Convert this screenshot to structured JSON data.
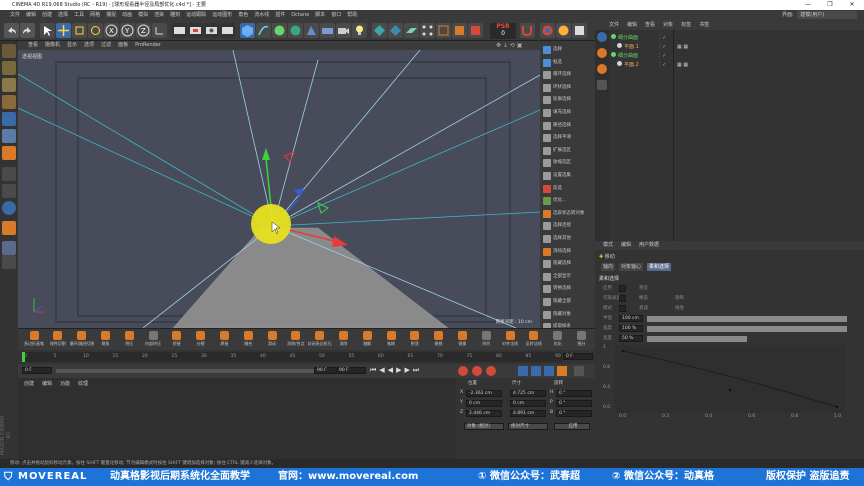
{
  "window": {
    "title": "CINEMA 4D R19.068 Studio (RC - R19) - [球形观看器半径及局部优化.c4d *] - 主要",
    "controls": [
      "—",
      "❐",
      "✕"
    ]
  },
  "menu": [
    "文件",
    "编辑",
    "创建",
    "选择",
    "工具",
    "网格",
    "捕捉",
    "动画",
    "模拟",
    "渲染",
    "雕刻",
    "运动跟踪",
    "运动图形",
    "角色",
    "流水线",
    "插件",
    "Octane",
    "脚本",
    "窗口",
    "帮助"
  ],
  "layout": {
    "label": "界面:",
    "value": "建模(用户)"
  },
  "psr": {
    "label": "PSR",
    "value": "0"
  },
  "viewport": {
    "menu": [
      "查看",
      "摄像机",
      "显示",
      "选项",
      "过滤",
      "面板",
      "ProRender"
    ],
    "name": "透视视图",
    "grid_label": "网格间距 : 10 cm"
  },
  "right_tools": [
    {
      "label": "选择",
      "color": "#4a8fd8"
    },
    {
      "label": "框选",
      "color": "#4a8fd8"
    },
    {
      "label": "循环选择",
      "color": "#9a9a9a"
    },
    {
      "label": "环状选择",
      "color": "#9a9a9a"
    },
    {
      "label": "轮廓选择",
      "color": "#9a9a9a"
    },
    {
      "label": "填充选择",
      "color": "#9a9a9a"
    },
    {
      "label": "路径选择",
      "color": "#9a9a9a"
    },
    {
      "label": "选择平滑",
      "color": "#9a9a9a"
    },
    {
      "label": "扩展选区",
      "color": "#9a9a9a"
    },
    {
      "label": "收缩选区",
      "color": "#9a9a9a"
    },
    {
      "label": "设置选集",
      "color": "#9a9a9a"
    },
    {
      "label": "反选",
      "color": "#d24a3a"
    },
    {
      "label": "优化...",
      "color": "#6a9a4a"
    },
    {
      "label": "选取状态转对象",
      "color": "#d87a2a"
    },
    {
      "label": "选择连接",
      "color": "#9a9a9a"
    },
    {
      "label": "选择其他",
      "color": "#9a9a9a"
    },
    {
      "label": "消除选择",
      "color": "#d87a2a"
    },
    {
      "label": "隐藏选择",
      "color": "#9a9a9a"
    },
    {
      "label": "全部显示",
      "color": "#9a9a9a"
    },
    {
      "label": "转换选择",
      "color": "#9a9a9a"
    },
    {
      "label": "隐藏全部",
      "color": "#9a9a9a"
    },
    {
      "label": "隐藏对象",
      "color": "#9a9a9a"
    },
    {
      "label": "提取样条",
      "color": "#9a9a9a"
    }
  ],
  "mod_tools": [
    {
      "label": "多边形画笔",
      "color": "#d87a2a"
    },
    {
      "label": "线性切割",
      "color": "#d87a2a"
    },
    {
      "label": "循环/路径切割",
      "color": "#d87a2a"
    },
    {
      "label": "倒角",
      "color": "#d87a2a"
    },
    {
      "label": "挤压",
      "color": "#d87a2a"
    },
    {
      "label": "内部挤压",
      "color": "#777"
    },
    {
      "label": "桥接",
      "color": "#d87a2a"
    },
    {
      "label": "分裂",
      "color": "#d87a2a"
    },
    {
      "label": "焊接",
      "color": "#d87a2a"
    },
    {
      "label": "缝合",
      "color": "#d87a2a"
    },
    {
      "label": "滑动",
      "color": "#d87a2a"
    },
    {
      "label": "消除/合点",
      "color": "#d87a2a"
    },
    {
      "label": "封闭多边形孔洞",
      "color": "#d87a2a"
    },
    {
      "label": "消除",
      "color": "#d87a2a"
    },
    {
      "label": "融解",
      "color": "#d87a2a"
    },
    {
      "label": "笔刷",
      "color": "#d87a2a"
    },
    {
      "label": "熨烫",
      "color": "#d87a2a"
    },
    {
      "label": "磁铁",
      "color": "#d87a2a"
    },
    {
      "label": "镜像",
      "color": "#d87a2a"
    },
    {
      "label": "阵列",
      "color": "#777"
    },
    {
      "label": "对齐法线",
      "color": "#d87a2a"
    },
    {
      "label": "反转法线",
      "color": "#d87a2a"
    },
    {
      "label": "优化",
      "color": "#777"
    },
    {
      "label": "细分",
      "color": "#777"
    }
  ],
  "timeline": {
    "ticks": [
      "0",
      "5",
      "10",
      "15",
      "20",
      "25",
      "30",
      "35",
      "40",
      "45",
      "50",
      "55",
      "60",
      "65",
      "70",
      "75",
      "80",
      "85",
      "90"
    ],
    "end": "0 F"
  },
  "playback": {
    "start": "0 F",
    "current": "90 F",
    "end": "90 F"
  },
  "materials": {
    "menu": [
      "创建",
      "编辑",
      "功能",
      "纹理"
    ]
  },
  "coords": {
    "headers": [
      "位置",
      "尺寸",
      "旋转"
    ],
    "rows": [
      {
        "axis": "X",
        "pos": "-2.362 cm",
        "size": "4.725 cm",
        "rlabel": "H",
        "rot": "0 °"
      },
      {
        "axis": "Y",
        "pos": "0 cm",
        "size": "0 cm",
        "rlabel": "P",
        "rot": "0 °"
      },
      {
        "axis": "Z",
        "pos": "2.446 cm",
        "size": "4.891 cm",
        "rlabel": "B",
        "rot": "0 °"
      }
    ],
    "mode": "对象 (相对)",
    "sizemode": "绝对尺寸",
    "apply": "应用"
  },
  "objects": {
    "menu": [
      "文件",
      "编辑",
      "查看",
      "对象",
      "标签",
      "书签"
    ],
    "items": [
      {
        "name": "细分曲面",
        "indent": 0,
        "color": "#6ad46a"
      },
      {
        "name": "平面.1",
        "indent": 1,
        "color": "#d4d4d4"
      },
      {
        "name": "细分曲面",
        "indent": 0,
        "color": "#6ad46a"
      },
      {
        "name": "平面.2",
        "indent": 1,
        "color": "#d4d4d4"
      }
    ]
  },
  "attributes": {
    "menu": [
      "模式",
      "编辑",
      "用户数据"
    ],
    "tool": "移动",
    "tabs": [
      "轴向",
      "对象轴心",
      "柔和选择"
    ],
    "section": "柔和选择",
    "rows": [
      {
        "label": "启用",
        "value": "",
        "extra": "预览"
      },
      {
        "label": "仅限表面",
        "value": "",
        "extra": "橡皮",
        "extra2": "限制"
      },
      {
        "label": "模式",
        "value": "",
        "extra": "衰减",
        "extra2": "线性"
      },
      {
        "label": "半径",
        "value": "100 cm"
      },
      {
        "label": "强度",
        "value": "100 %"
      },
      {
        "label": "宽度",
        "value": "50 %"
      }
    ],
    "graph": {
      "xticks": [
        "0.0",
        "0.2",
        "0.4",
        "0.6",
        "0.8",
        "1.0"
      ],
      "yticks": [
        "1",
        "0.8",
        "0.4",
        "0.0"
      ]
    }
  },
  "status": "移动: 点击并拖动鼠标移动元素。按住 SHIFT 键量化移动; 节点编辑模式时按住 SHIFT 键增加选择对象; 按住 CTRL 键减少选择对象。",
  "watermark": {
    "line1": "MAXON",
    "line2": "CINEMA 4D"
  },
  "banner": {
    "logo": "MOVEREAL",
    "slogan": "动真格影视后期系统化全面教学",
    "site": "官网：www.movereal.com",
    "wechat1": "① 微信公众号：武春超",
    "wechat2": "② 微信公众号：动真格",
    "rights": "版权保护 盗版追责"
  },
  "colors": {
    "accent": "#1e73d8",
    "cursor": "#e8e020"
  }
}
